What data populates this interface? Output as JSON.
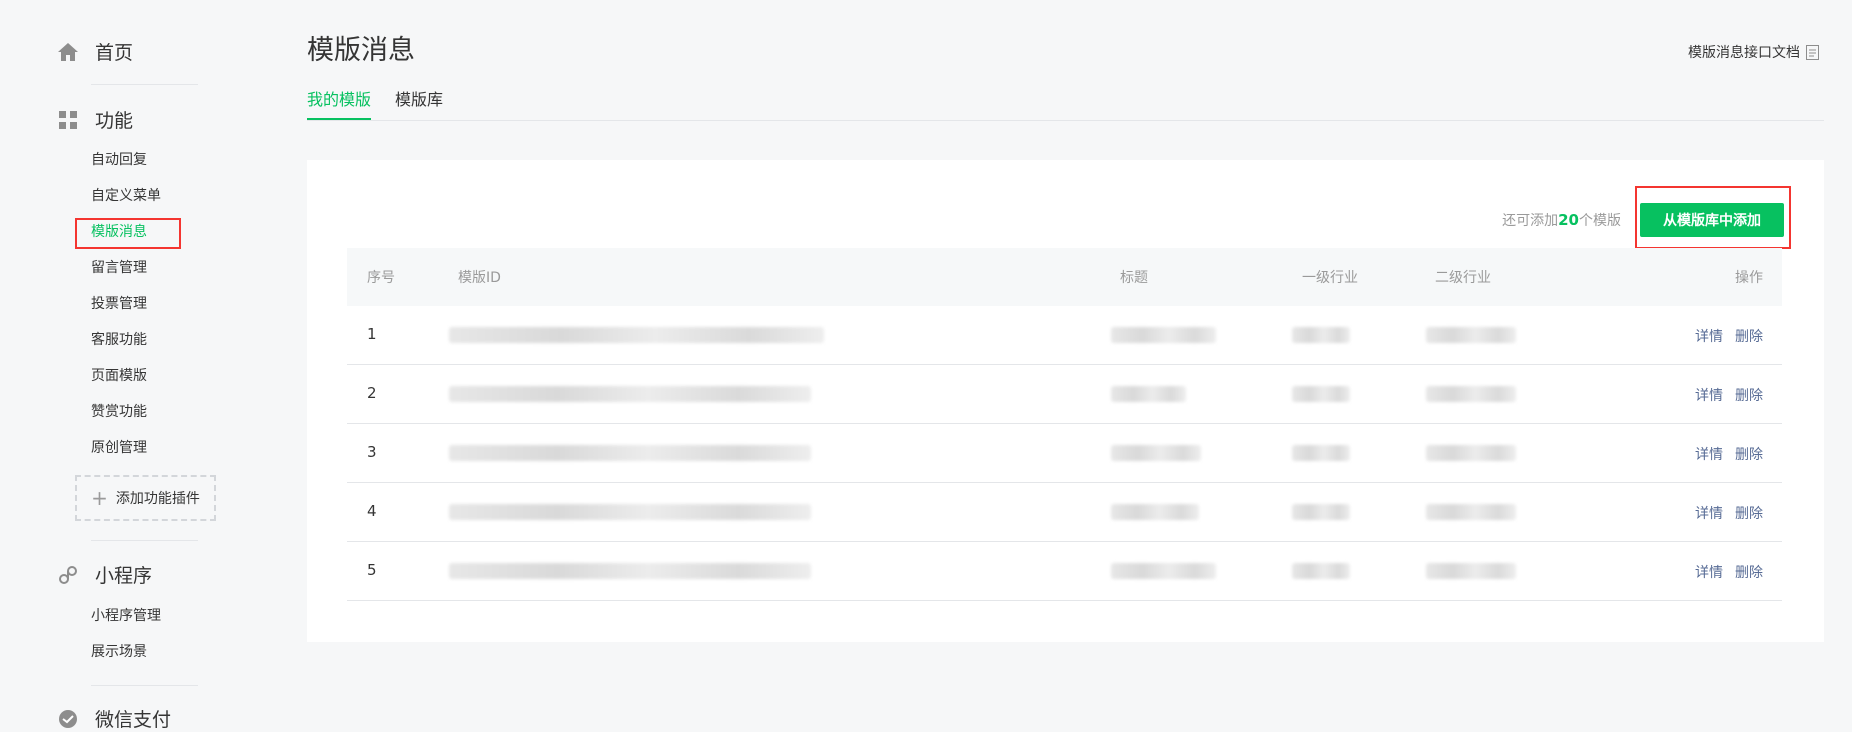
{
  "sidebar": {
    "home": {
      "label": "首页",
      "icon": "home-icon"
    },
    "functions": {
      "label": "功能",
      "icon": "grid-icon"
    },
    "function_items": [
      {
        "label": "自动回复",
        "active": false
      },
      {
        "label": "自定义菜单",
        "active": false
      },
      {
        "label": "模版消息",
        "active": true
      },
      {
        "label": "留言管理",
        "active": false
      },
      {
        "label": "投票管理",
        "active": false
      },
      {
        "label": "客服功能",
        "active": false
      },
      {
        "label": "页面模版",
        "active": false
      },
      {
        "label": "赞赏功能",
        "active": false
      },
      {
        "label": "原创管理",
        "active": false
      }
    ],
    "add_plugin_label": "添加功能插件",
    "miniprogram": {
      "label": "小程序",
      "icon": "link-icon"
    },
    "miniprogram_items": [
      {
        "label": "小程序管理"
      },
      {
        "label": "展示场景"
      }
    ],
    "wechat_pay": {
      "label": "微信支付",
      "icon": "wechat-pay-icon"
    }
  },
  "header": {
    "title": "模版消息",
    "doc_link": "模版消息接口文档"
  },
  "tabs": [
    {
      "label": "我的模版",
      "active": true
    },
    {
      "label": "模版库",
      "active": false
    }
  ],
  "panel": {
    "quota_prefix": "还可添加",
    "quota_count": "20",
    "quota_suffix": "个模版",
    "add_button": "从模版库中添加"
  },
  "table": {
    "headers": [
      "序号",
      "模版ID",
      "标题",
      "一级行业",
      "二级行业",
      "操作"
    ],
    "rows": [
      {
        "index": "1"
      },
      {
        "index": "2"
      },
      {
        "index": "3"
      },
      {
        "index": "4"
      },
      {
        "index": "5"
      }
    ],
    "detail_label": "详情",
    "delete_label": "删除"
  },
  "colors": {
    "accent": "#07c160",
    "highlight": "#f43530",
    "link": "#576b95"
  }
}
